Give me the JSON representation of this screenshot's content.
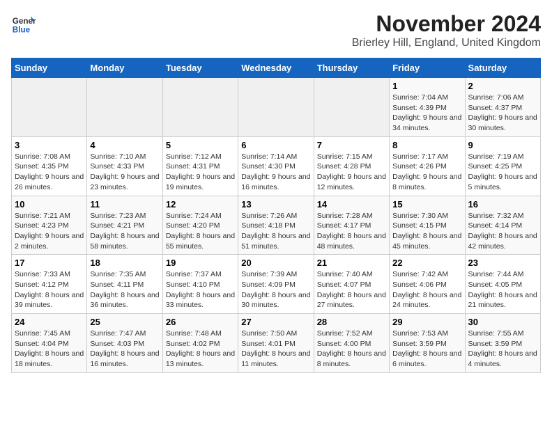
{
  "header": {
    "logo_line1": "General",
    "logo_line2": "Blue",
    "month": "November 2024",
    "location": "Brierley Hill, England, United Kingdom"
  },
  "weekdays": [
    "Sunday",
    "Monday",
    "Tuesday",
    "Wednesday",
    "Thursday",
    "Friday",
    "Saturday"
  ],
  "weeks": [
    [
      {
        "day": "",
        "sunrise": "",
        "sunset": "",
        "daylight": ""
      },
      {
        "day": "",
        "sunrise": "",
        "sunset": "",
        "daylight": ""
      },
      {
        "day": "",
        "sunrise": "",
        "sunset": "",
        "daylight": ""
      },
      {
        "day": "",
        "sunrise": "",
        "sunset": "",
        "daylight": ""
      },
      {
        "day": "",
        "sunrise": "",
        "sunset": "",
        "daylight": ""
      },
      {
        "day": "1",
        "sunrise": "Sunrise: 7:04 AM",
        "sunset": "Sunset: 4:39 PM",
        "daylight": "Daylight: 9 hours and 34 minutes."
      },
      {
        "day": "2",
        "sunrise": "Sunrise: 7:06 AM",
        "sunset": "Sunset: 4:37 PM",
        "daylight": "Daylight: 9 hours and 30 minutes."
      }
    ],
    [
      {
        "day": "3",
        "sunrise": "Sunrise: 7:08 AM",
        "sunset": "Sunset: 4:35 PM",
        "daylight": "Daylight: 9 hours and 26 minutes."
      },
      {
        "day": "4",
        "sunrise": "Sunrise: 7:10 AM",
        "sunset": "Sunset: 4:33 PM",
        "daylight": "Daylight: 9 hours and 23 minutes."
      },
      {
        "day": "5",
        "sunrise": "Sunrise: 7:12 AM",
        "sunset": "Sunset: 4:31 PM",
        "daylight": "Daylight: 9 hours and 19 minutes."
      },
      {
        "day": "6",
        "sunrise": "Sunrise: 7:14 AM",
        "sunset": "Sunset: 4:30 PM",
        "daylight": "Daylight: 9 hours and 16 minutes."
      },
      {
        "day": "7",
        "sunrise": "Sunrise: 7:15 AM",
        "sunset": "Sunset: 4:28 PM",
        "daylight": "Daylight: 9 hours and 12 minutes."
      },
      {
        "day": "8",
        "sunrise": "Sunrise: 7:17 AM",
        "sunset": "Sunset: 4:26 PM",
        "daylight": "Daylight: 9 hours and 8 minutes."
      },
      {
        "day": "9",
        "sunrise": "Sunrise: 7:19 AM",
        "sunset": "Sunset: 4:25 PM",
        "daylight": "Daylight: 9 hours and 5 minutes."
      }
    ],
    [
      {
        "day": "10",
        "sunrise": "Sunrise: 7:21 AM",
        "sunset": "Sunset: 4:23 PM",
        "daylight": "Daylight: 9 hours and 2 minutes."
      },
      {
        "day": "11",
        "sunrise": "Sunrise: 7:23 AM",
        "sunset": "Sunset: 4:21 PM",
        "daylight": "Daylight: 8 hours and 58 minutes."
      },
      {
        "day": "12",
        "sunrise": "Sunrise: 7:24 AM",
        "sunset": "Sunset: 4:20 PM",
        "daylight": "Daylight: 8 hours and 55 minutes."
      },
      {
        "day": "13",
        "sunrise": "Sunrise: 7:26 AM",
        "sunset": "Sunset: 4:18 PM",
        "daylight": "Daylight: 8 hours and 51 minutes."
      },
      {
        "day": "14",
        "sunrise": "Sunrise: 7:28 AM",
        "sunset": "Sunset: 4:17 PM",
        "daylight": "Daylight: 8 hours and 48 minutes."
      },
      {
        "day": "15",
        "sunrise": "Sunrise: 7:30 AM",
        "sunset": "Sunset: 4:15 PM",
        "daylight": "Daylight: 8 hours and 45 minutes."
      },
      {
        "day": "16",
        "sunrise": "Sunrise: 7:32 AM",
        "sunset": "Sunset: 4:14 PM",
        "daylight": "Daylight: 8 hours and 42 minutes."
      }
    ],
    [
      {
        "day": "17",
        "sunrise": "Sunrise: 7:33 AM",
        "sunset": "Sunset: 4:12 PM",
        "daylight": "Daylight: 8 hours and 39 minutes."
      },
      {
        "day": "18",
        "sunrise": "Sunrise: 7:35 AM",
        "sunset": "Sunset: 4:11 PM",
        "daylight": "Daylight: 8 hours and 36 minutes."
      },
      {
        "day": "19",
        "sunrise": "Sunrise: 7:37 AM",
        "sunset": "Sunset: 4:10 PM",
        "daylight": "Daylight: 8 hours and 33 minutes."
      },
      {
        "day": "20",
        "sunrise": "Sunrise: 7:39 AM",
        "sunset": "Sunset: 4:09 PM",
        "daylight": "Daylight: 8 hours and 30 minutes."
      },
      {
        "day": "21",
        "sunrise": "Sunrise: 7:40 AM",
        "sunset": "Sunset: 4:07 PM",
        "daylight": "Daylight: 8 hours and 27 minutes."
      },
      {
        "day": "22",
        "sunrise": "Sunrise: 7:42 AM",
        "sunset": "Sunset: 4:06 PM",
        "daylight": "Daylight: 8 hours and 24 minutes."
      },
      {
        "day": "23",
        "sunrise": "Sunrise: 7:44 AM",
        "sunset": "Sunset: 4:05 PM",
        "daylight": "Daylight: 8 hours and 21 minutes."
      }
    ],
    [
      {
        "day": "24",
        "sunrise": "Sunrise: 7:45 AM",
        "sunset": "Sunset: 4:04 PM",
        "daylight": "Daylight: 8 hours and 18 minutes."
      },
      {
        "day": "25",
        "sunrise": "Sunrise: 7:47 AM",
        "sunset": "Sunset: 4:03 PM",
        "daylight": "Daylight: 8 hours and 16 minutes."
      },
      {
        "day": "26",
        "sunrise": "Sunrise: 7:48 AM",
        "sunset": "Sunset: 4:02 PM",
        "daylight": "Daylight: 8 hours and 13 minutes."
      },
      {
        "day": "27",
        "sunrise": "Sunrise: 7:50 AM",
        "sunset": "Sunset: 4:01 PM",
        "daylight": "Daylight: 8 hours and 11 minutes."
      },
      {
        "day": "28",
        "sunrise": "Sunrise: 7:52 AM",
        "sunset": "Sunset: 4:00 PM",
        "daylight": "Daylight: 8 hours and 8 minutes."
      },
      {
        "day": "29",
        "sunrise": "Sunrise: 7:53 AM",
        "sunset": "Sunset: 3:59 PM",
        "daylight": "Daylight: 8 hours and 6 minutes."
      },
      {
        "day": "30",
        "sunrise": "Sunrise: 7:55 AM",
        "sunset": "Sunset: 3:59 PM",
        "daylight": "Daylight: 8 hours and 4 minutes."
      }
    ]
  ]
}
